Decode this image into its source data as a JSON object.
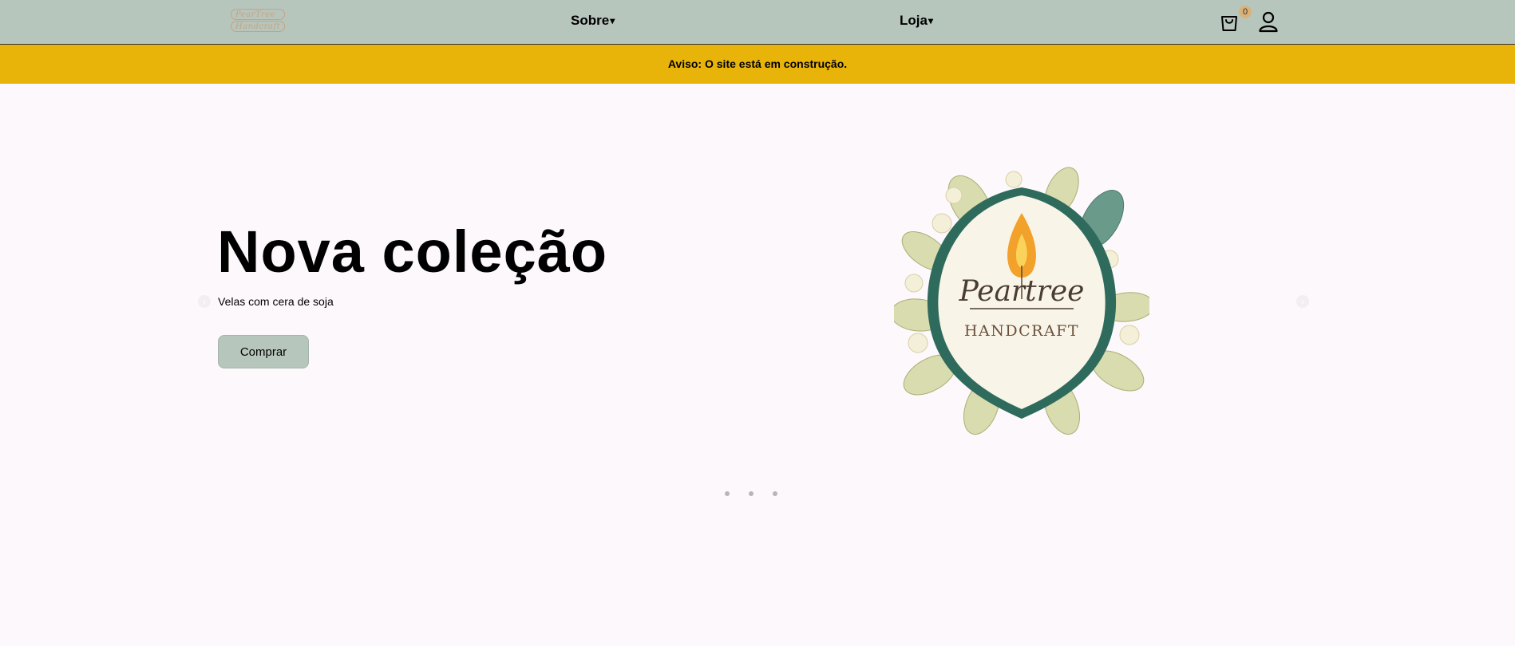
{
  "header": {
    "logo": {
      "line1": "PearTree",
      "line2": "Handcraft"
    },
    "nav": [
      {
        "label": "Sobre",
        "caret": "▾"
      },
      {
        "label": "Loja",
        "caret": "▾"
      }
    ],
    "cart": {
      "count": "0",
      "icon": "shopping-bag-icon"
    },
    "user": {
      "icon": "user-icon"
    }
  },
  "notice": {
    "text": "Aviso: O site está em construção."
  },
  "hero": {
    "title": "Nova coleção",
    "subtitle": "Velas com cera de soja",
    "button_label": "Comprar",
    "image": {
      "brand_line1": "Peartree",
      "brand_line2": "HANDCRAFT"
    },
    "prev_icon": "chevron-left-icon",
    "next_icon": "chevron-right-icon",
    "slides_count": 3
  },
  "colors": {
    "header_bg": "#b7c6bd",
    "notice_bg": "#e9b40a",
    "page_bg": "#fdf8fb",
    "accent_gold": "#c9a27e"
  }
}
